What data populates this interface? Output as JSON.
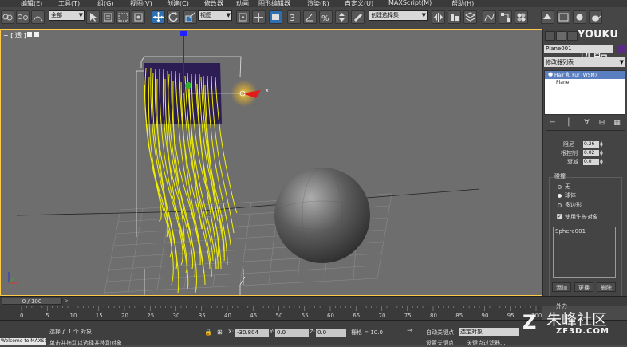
{
  "menu": {
    "items": [
      "编辑(E)",
      "工具(T)",
      "组(G)",
      "视图(V)",
      "创建(C)",
      "修改器",
      "动画",
      "图形编辑器",
      "渲染(R)",
      "自定义(U)",
      "MAXScript(M)",
      "帮助(H)"
    ]
  },
  "toolbar": {
    "selection_filter": "全部",
    "ref_coord": "视图",
    "named_selection": "创建选择集"
  },
  "viewport": {
    "label": "+ [ 透 ]",
    "background": "#6e6e6e",
    "border_color": "#ffc94a"
  },
  "command_panel": {
    "object_name": "Plane001",
    "object_color": "#5b2a87",
    "modifier_list": "修改器列表",
    "stack": [
      "Hair 和 Fur (WSM)",
      "Plane"
    ],
    "params": [
      {
        "label": "阻尼",
        "value": "0.26"
      },
      {
        "label": "根控制",
        "value": "0.02"
      },
      {
        "label": "衰减",
        "value": "0.0"
      }
    ],
    "collision_group": "碰撞",
    "collision_options": [
      "无",
      "球体",
      "多边形"
    ],
    "collision_selected": 1,
    "use_growth": "使用生长对象",
    "use_growth_checked": true,
    "collision_target": "Sphere001",
    "buttons": [
      "添加",
      "更换",
      "删除"
    ],
    "external_force": "外力"
  },
  "watermarks": {
    "youku": "YOUKU",
    "youku_cn": "优酷",
    "zf_name": "朱峰社区",
    "zf_url": "ZF3D.COM"
  },
  "timeline": {
    "frame_display": "0 / 100",
    "ticks": [
      "0",
      "5",
      "10",
      "15",
      "20",
      "25",
      "30",
      "35",
      "40",
      "45",
      "50",
      "55",
      "60",
      "65",
      "70",
      "75",
      "80",
      "85",
      "90",
      "95",
      "100"
    ]
  },
  "status": {
    "message": "选择了 1 个 对象",
    "message2": "单击并拖动以选择并移动对象",
    "listener": "Welcome to MAXScript.",
    "x_label": "X:",
    "x_value": "-30.804",
    "y_label": "Y:",
    "y_value": "0.0",
    "z_label": "Z:",
    "z_value": "0.0",
    "grid": "栅格 = 10.0",
    "auto_key": "自动关键点",
    "selected_object": "选定对象",
    "set_key": "设置关键点",
    "key_filters": "关键点过滤器..."
  }
}
